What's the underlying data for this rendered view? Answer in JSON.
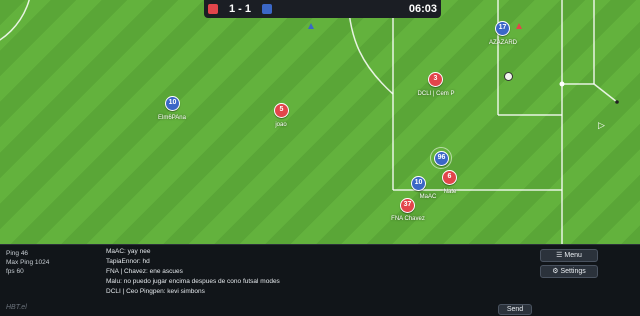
{
  "scoreboard": {
    "home_color": "#e2454b",
    "away_color": "#3b67c6",
    "score": "1 - 1",
    "clock": "06:03"
  },
  "players": [
    {
      "number": "10",
      "name": "Elm6PAna",
      "team": "blue",
      "selected": false
    },
    {
      "number": "5",
      "name": "joao",
      "team": "red",
      "selected": false
    },
    {
      "number": "3",
      "name": "DCLI | Cem P",
      "team": "red",
      "selected": false
    },
    {
      "number": "17",
      "name": "AZAZARD",
      "team": "blue",
      "selected": false
    },
    {
      "number": "96",
      "name": "",
      "team": "blue",
      "selected": true
    },
    {
      "number": "6",
      "name": "Nate",
      "team": "red",
      "selected": false
    },
    {
      "number": "10",
      "name": "MaAC",
      "team": "blue",
      "selected": false
    },
    {
      "number": "37",
      "name": "FNA Chavez",
      "team": "red",
      "selected": false
    }
  ],
  "stats": {
    "ping": "Ping 46",
    "max_ping": "Max Ping 1024",
    "fps": "fps 60"
  },
  "chat": [
    "MaAC: yay nee",
    "TapiaEnnor: hd",
    "FNA | Chavez: ene ascues",
    "Malu: no puedo jugar encima despues de cono futsal modes",
    "DCLI | Ceo Pingpen: kevi simbons"
  ],
  "buttons": {
    "menu": "Menu",
    "settings": "Settings",
    "send": "Send"
  },
  "logo": "HBT.el",
  "icons": {
    "menu": "list-icon",
    "settings": "gear-icon",
    "cursor": "pointer-icon"
  }
}
